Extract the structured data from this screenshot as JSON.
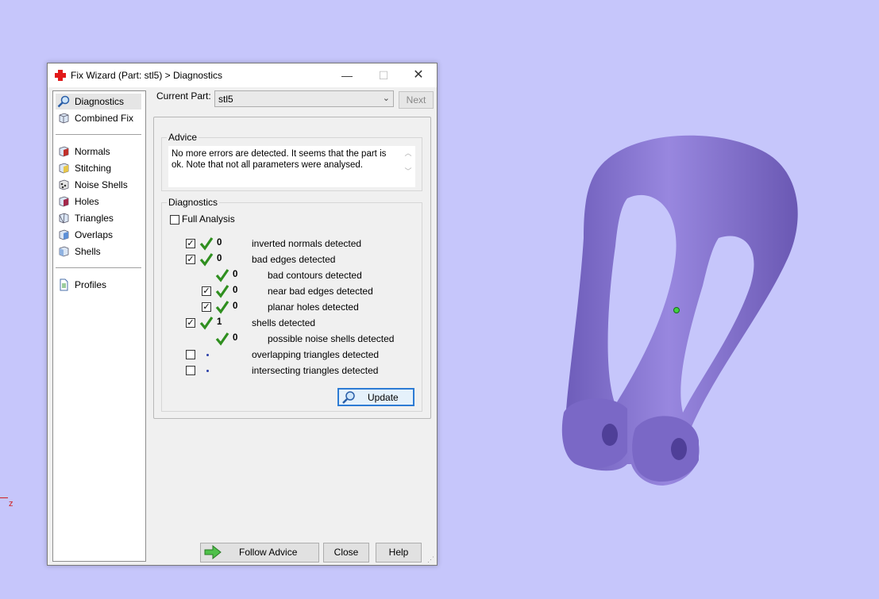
{
  "viewport": {
    "axis_label": "z",
    "model_color": "#8e7cd6",
    "background": "#c6c6fb"
  },
  "dialog": {
    "title": "Fix Wizard (Part: stl5) > Diagnostics",
    "title_icon": "red-cross-icon",
    "controls": {
      "minimize": "—",
      "maximize": "☐",
      "close": "✕"
    }
  },
  "sidebar": {
    "items": [
      {
        "label": "Diagnostics",
        "icon": "magnifier-icon",
        "selected": true
      },
      {
        "label": "Combined Fix",
        "icon": "cube-icon"
      },
      {
        "label": "Normals",
        "icon": "normals-cube-icon"
      },
      {
        "label": "Stitching",
        "icon": "stitching-cube-icon"
      },
      {
        "label": "Noise Shells",
        "icon": "noise-shells-icon"
      },
      {
        "label": "Holes",
        "icon": "holes-cube-icon"
      },
      {
        "label": "Triangles",
        "icon": "triangles-icon"
      },
      {
        "label": "Overlaps",
        "icon": "overlaps-cube-icon"
      },
      {
        "label": "Shells",
        "icon": "shells-cube-icon"
      },
      {
        "label": "Profiles",
        "icon": "document-icon"
      }
    ]
  },
  "current_part": {
    "label": "Current Part:",
    "value": "stl5",
    "next_label": "Next"
  },
  "advice": {
    "title": "Advice",
    "text": "No more errors are detected. It seems that the part is ok. Note that not all parameters were analysed."
  },
  "diagnostics": {
    "title": "Diagnostics",
    "full_analysis_label": "Full Analysis",
    "full_analysis_checked": false,
    "rows": [
      {
        "checkbox": true,
        "checked": true,
        "status": "ok",
        "count": "0",
        "label": "inverted normals detected",
        "indent": 0
      },
      {
        "checkbox": true,
        "checked": true,
        "status": "ok",
        "count": "0",
        "label": "bad edges detected",
        "indent": 0
      },
      {
        "checkbox": false,
        "checked": false,
        "status": "ok",
        "count": "0",
        "label": "bad contours detected",
        "indent": 1
      },
      {
        "checkbox": true,
        "checked": true,
        "status": "ok",
        "count": "0",
        "label": "near bad edges detected",
        "indent": 1
      },
      {
        "checkbox": true,
        "checked": true,
        "status": "ok",
        "count": "0",
        "label": "planar holes detected",
        "indent": 1
      },
      {
        "checkbox": true,
        "checked": true,
        "status": "ok",
        "count": "1",
        "label": "shells detected",
        "indent": 0
      },
      {
        "checkbox": false,
        "checked": false,
        "status": "ok",
        "count": "0",
        "label": "possible noise shells detected",
        "indent": 1
      },
      {
        "checkbox": true,
        "checked": false,
        "status": "none",
        "count": "",
        "label": "overlapping triangles detected",
        "indent": 0
      },
      {
        "checkbox": true,
        "checked": false,
        "status": "none",
        "count": "",
        "label": "intersecting triangles detected",
        "indent": 0
      }
    ],
    "update_label": "Update",
    "check_color": "#2f8f1f"
  },
  "footer": {
    "follow_advice": "Follow Advice",
    "close": "Close",
    "help": "Help"
  }
}
